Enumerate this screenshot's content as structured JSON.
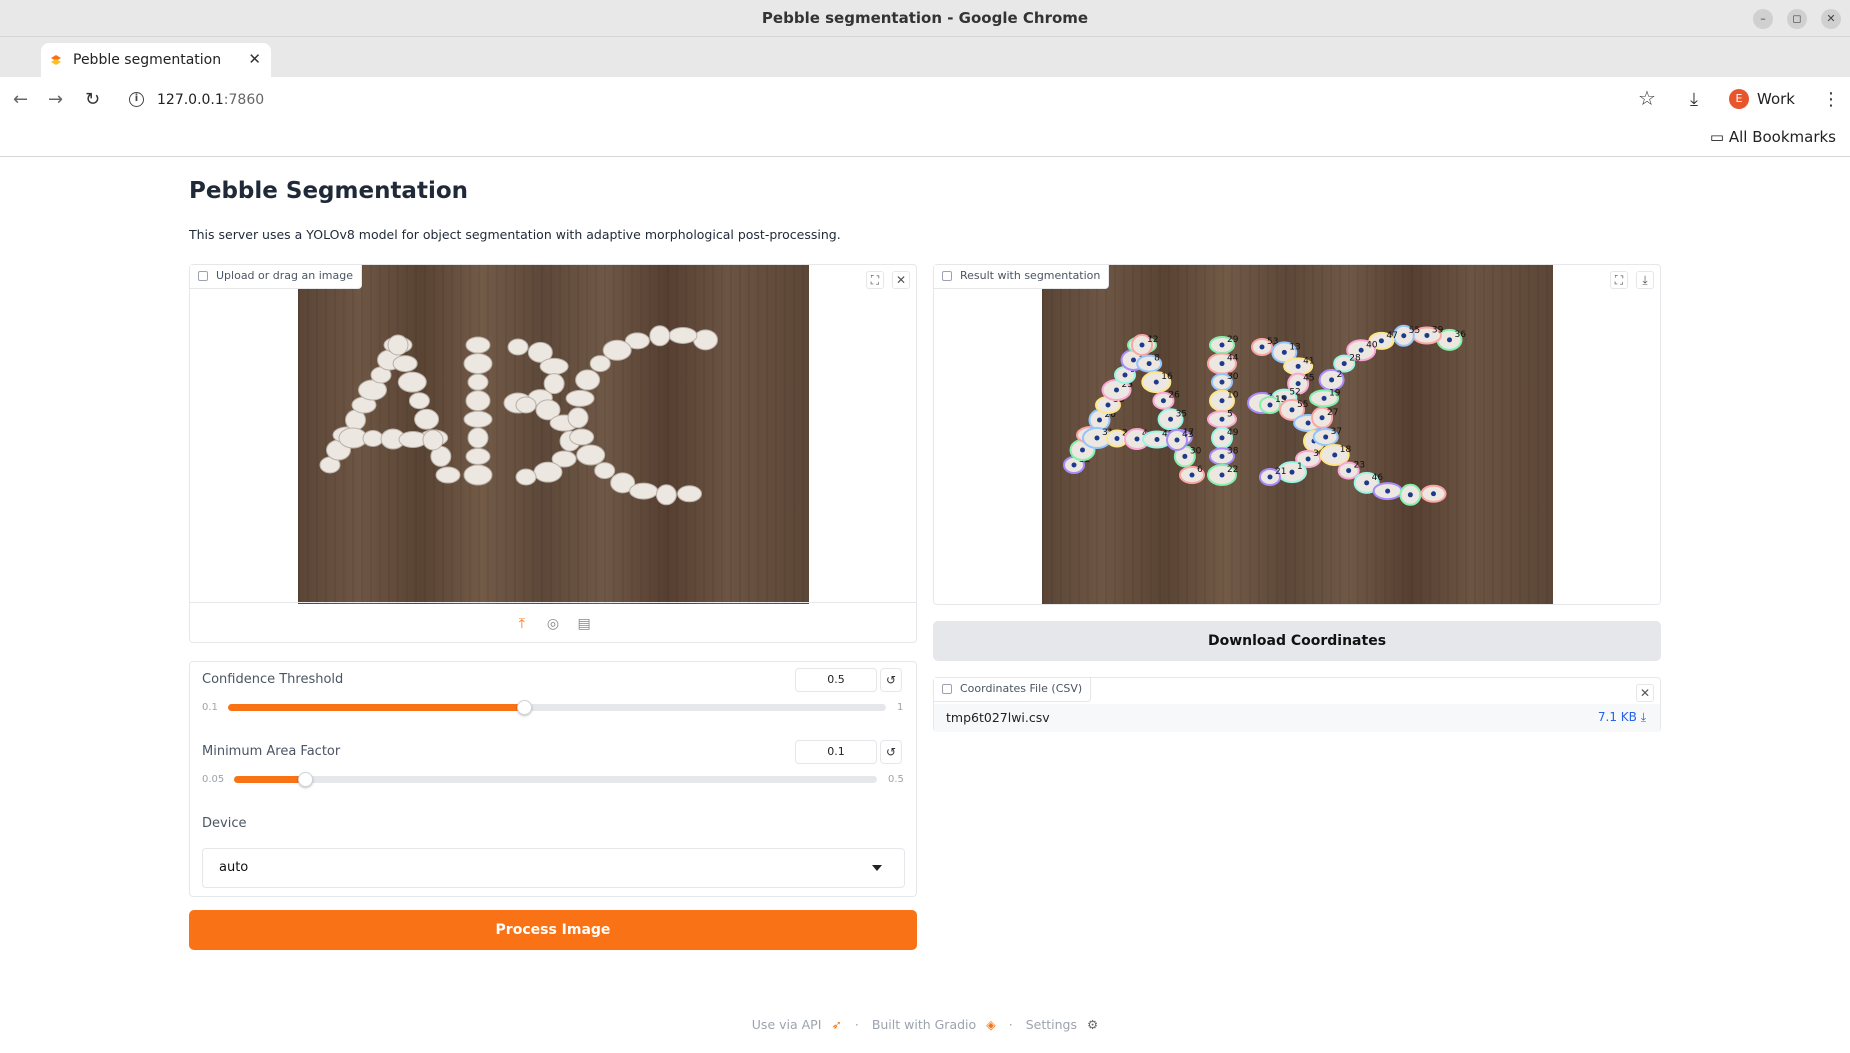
{
  "window": {
    "title": "Pebble segmentation - Google Chrome",
    "controls": [
      "–",
      "◻",
      "✕"
    ]
  },
  "tabs": {
    "active_title": "Pebble segmentation",
    "close": "✕",
    "new_tab": "+",
    "menu": "⌄"
  },
  "navbar": {
    "back": "←",
    "forward": "→",
    "reload": "↻",
    "url_host": "127.0.0.1",
    "url_port": ":7860",
    "bookmark_star": "☆",
    "download": "⤓",
    "menu": "⋮"
  },
  "profile": {
    "initial": "E",
    "name": "Work"
  },
  "bookmarks": {
    "all_bookmarks": "All Bookmarks"
  },
  "page": {
    "title": "Pebble Segmentation",
    "description": "This server uses a YOLOv8 model for object segmentation with adaptive morphological post-processing."
  },
  "input_image": {
    "label": "Upload or drag an image",
    "fullscreen": "⛶",
    "clear": "✕"
  },
  "output_image": {
    "label": "Result with segmentation",
    "fullscreen": "⛶",
    "download": "⤓"
  },
  "controls": {
    "confidence": {
      "label": "Confidence Threshold",
      "value": "0.5",
      "min": "0.1",
      "max": "1",
      "fraction": 0.45
    },
    "min_area": {
      "label": "Minimum Area Factor",
      "value": "0.1",
      "min": "0.05",
      "max": "0.5",
      "fraction": 0.11
    },
    "device": {
      "label": "Device",
      "value": "auto"
    },
    "reset": "↺"
  },
  "buttons": {
    "process": "Process Image",
    "download_coords": "Download Coordinates"
  },
  "file": {
    "label": "Coordinates File (CSV)",
    "name": "tmp6t027lwi.csv",
    "size": "7.1 KB ⤓",
    "clear": "✕"
  },
  "footer": {
    "api": "Use via API",
    "built": "Built with Gradio",
    "settings": "Settings",
    "sep": "·"
  },
  "pebble_ids": [
    "32",
    "42",
    "54",
    "20",
    "33",
    "25",
    "9",
    "1",
    "4",
    "12",
    "8",
    "16",
    "26",
    "35",
    "17",
    "30",
    "6",
    "31",
    "24",
    "4",
    "48",
    "43",
    "29",
    "44",
    "30",
    "10",
    "5",
    "49",
    "38",
    "22",
    "53",
    "13",
    "41",
    "45",
    "52",
    "7",
    "15",
    "55",
    "34",
    "51",
    "3",
    "1",
    "21",
    "36",
    "39",
    "55",
    "47",
    "40",
    "28",
    "2",
    "19",
    "27",
    "37",
    "18",
    "23",
    "46"
  ],
  "accent_color": "#f97316"
}
